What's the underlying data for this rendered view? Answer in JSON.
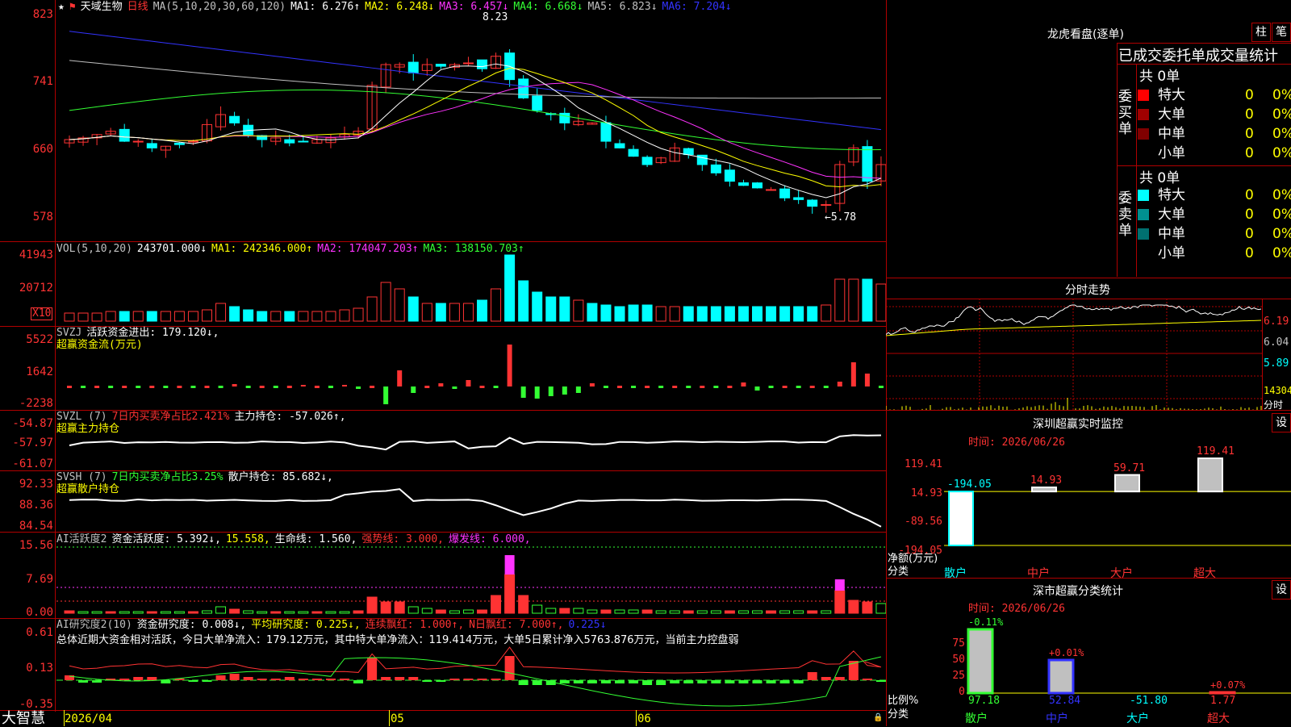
{
  "stock": {
    "name": "天域生物",
    "period": "日线",
    "star": "★"
  },
  "main_chart": {
    "ma_title": "MA(5,10,20,30,60,120)",
    "mas": [
      {
        "label": "MA1:",
        "value": "6.276↑",
        "color": "#ffffff"
      },
      {
        "label": "MA2:",
        "value": "6.248↓",
        "color": "#ffff00"
      },
      {
        "label": "MA3:",
        "value": "6.457↓",
        "color": "#ff33ff"
      },
      {
        "label": "MA4:",
        "value": "6.668↓",
        "color": "#33ff33"
      },
      {
        "label": "MA5:",
        "value": "6.823↓",
        "color": "#c0c0c0"
      },
      {
        "label": "MA6:",
        "value": "7.204↓",
        "color": "#3333ff"
      }
    ],
    "axis": [
      "823",
      "741",
      "660",
      "578"
    ],
    "high_label": "8.23",
    "low_label": "←5.78"
  },
  "vol": {
    "title": "VOL(5,10,20)",
    "value": "243701.000↓",
    "ma1": "MA1: 242346.000↑",
    "ma2": "MA2: 174047.203↑",
    "ma3": "MA3: 138150.703↑",
    "axis": [
      "41943",
      "20712"
    ],
    "unit": "X10"
  },
  "svzj": {
    "title": "SVZJ",
    "t1": "活跃资金进出: 179.120↓,",
    "sub": "超赢资金流(万元)",
    "axis": [
      "5522",
      "1642",
      "-2238"
    ]
  },
  "svzl": {
    "title": "SVZL (7)",
    "t1": "7日内买卖净占比2.421%",
    "t2": "主力持仓: -57.026↑,",
    "sub": "超赢主力持仓",
    "axis": [
      "-54.87",
      "-57.97",
      "-61.07"
    ]
  },
  "svsh": {
    "title": "SVSH (7)",
    "t1": "7日内买卖净占比3.25%",
    "t2": "散户持仓: 85.682↓,",
    "sub": "超赢散户持仓",
    "axis": [
      "92.33",
      "88.36",
      "84.54"
    ]
  },
  "ai1": {
    "title": "AI活跃度2",
    "t1": "资金活跃度: 5.392↓,",
    "t2": "15.558,",
    "t3": "生命线: 1.560,",
    "t4": "强势线: 3.000,",
    "t5": "爆发线: 6.000,",
    "axis": [
      "15.56",
      "7.69",
      "0.00"
    ]
  },
  "ai2": {
    "title": "AI研究度2(10)",
    "t1": "资金研究度: 0.008↓,",
    "t2": "平均研究度: 0.225↓,",
    "t3": "连续飘红: 1.000↑,",
    "t4": "N日飘红: 7.000↑,",
    "t5": "0.225↓",
    "summary": "总体近期大资金相对活跃，今日大单净流入：179.12万元，其中特大单净流入：119.414万元，大单5日累计净入5763.876万元，当前主力控盘弱",
    "axis": [
      "0.61",
      "0.13",
      "-0.35"
    ]
  },
  "bottom": {
    "brand": "大智慧",
    "date": "2026/04",
    "m05": "05",
    "m06": "06"
  },
  "right": {
    "dragon_title": "龙虎看盘(逐单)",
    "btn_zhu": "柱",
    "btn_bi": "笔",
    "stat_title": "已成交委托单成交量统计",
    "buy": {
      "side": "委买单",
      "total": "共 0单",
      "rows": [
        {
          "label": "特大",
          "n": "0",
          "p": "0%",
          "color": "#ff0000"
        },
        {
          "label": "大单",
          "n": "0",
          "p": "0%",
          "color": "#a00000"
        },
        {
          "label": "中单",
          "n": "0",
          "p": "0%",
          "color": "#800000"
        },
        {
          "label": "小单",
          "n": "0",
          "p": "0%",
          "color": "#000000"
        }
      ]
    },
    "sell": {
      "side": "委卖单",
      "total": "共 0单",
      "rows": [
        {
          "label": "特大",
          "n": "0",
          "p": "0%",
          "color": "#00ffff"
        },
        {
          "label": "大单",
          "n": "0",
          "p": "0%",
          "color": "#009090"
        },
        {
          "label": "中单",
          "n": "0",
          "p": "0%",
          "color": "#007070"
        },
        {
          "label": "小单",
          "n": "0",
          "p": "0%",
          "color": "#000000"
        }
      ]
    },
    "intraday": {
      "title": "分时走势",
      "axis": [
        "6.19",
        "6.04",
        "5.89"
      ],
      "vol": "14304",
      "vol2": "分时"
    },
    "monitor": {
      "title": "深圳超赢实时监控",
      "btn": "设",
      "time": "时间: 2026/06/26",
      "axis": [
        "119.41",
        "14.93",
        "-89.56",
        "-194.05"
      ],
      "ylabel": "净额(万元)",
      "xlabel": "分类",
      "cats": [
        "散户",
        "中户",
        "大户",
        "超大"
      ],
      "values": [
        "-194.05",
        "14.93",
        "59.71",
        "119.41"
      ]
    },
    "classify": {
      "title": "深市超赢分类统计",
      "btn": "设",
      "time": "时间: 2026/06/26",
      "axis": [
        "75",
        "50",
        "25",
        "0"
      ],
      "ylabel": "比例%",
      "xlabel": "分类",
      "cats": [
        "散户",
        "中户",
        "大户",
        "超大"
      ],
      "top": [
        "-0.11%",
        "+0.01%",
        "",
        "+0.07%"
      ],
      "bottom": [
        "97.18",
        "52.84",
        "-51.80",
        "1.77"
      ]
    }
  }
}
